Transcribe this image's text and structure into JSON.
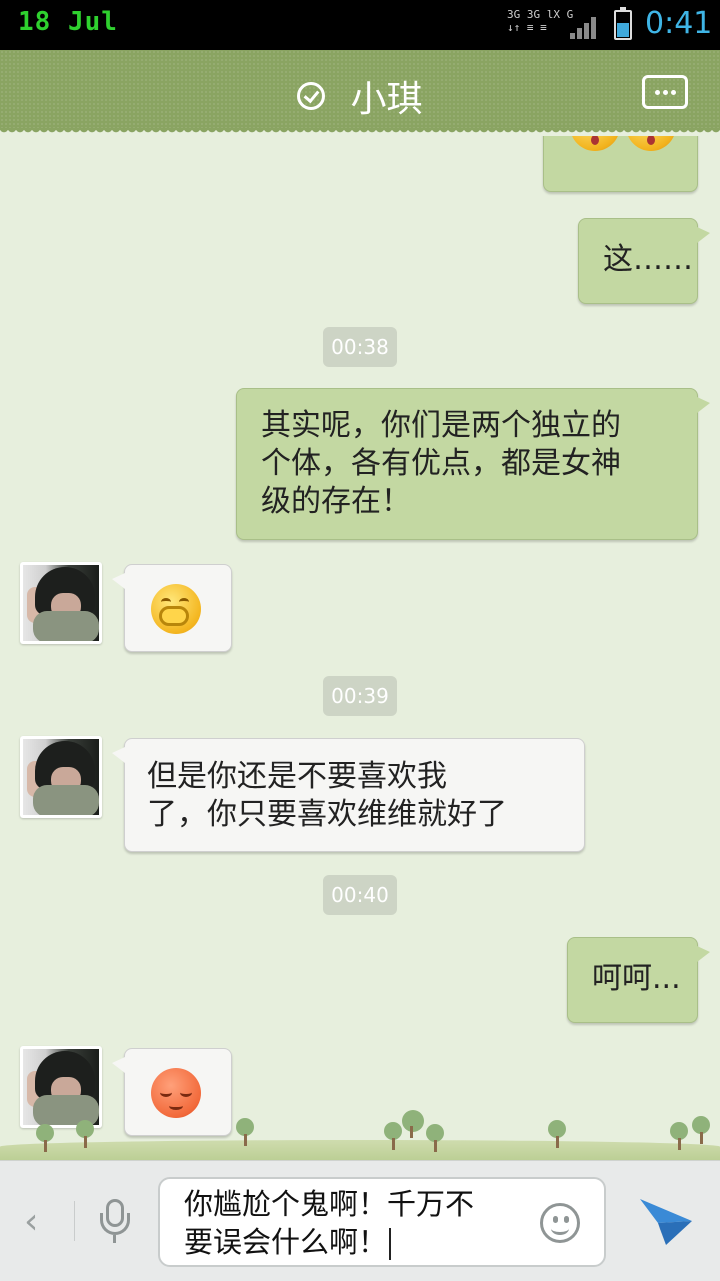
{
  "status_bar": {
    "date": "18 Jul",
    "network_top": "3G 3G lX G",
    "network_bottom": "↓↑ ≡ ≡",
    "time": "0:41",
    "battery_level": 0.55
  },
  "header": {
    "title": "小琪",
    "verified_icon": "check-circle-icon",
    "menu_icon": "more-dots-icon"
  },
  "messages": [
    {
      "side": "right",
      "type": "emoji",
      "emoji": [
        "shocked-face",
        "shocked-face"
      ]
    },
    {
      "side": "right",
      "type": "text",
      "text": "这……"
    },
    {
      "type": "time",
      "text": "00:38"
    },
    {
      "side": "right",
      "type": "text",
      "lines": [
        "其实呢，你们是两个独立的",
        "个体，各有优点，都是女神",
        "级的存在！"
      ]
    },
    {
      "side": "left",
      "type": "emoji",
      "emoji": [
        "hug-face"
      ]
    },
    {
      "type": "time",
      "text": "00:39"
    },
    {
      "side": "left",
      "type": "text",
      "lines": [
        "但是你还是不要喜欢我",
        "了，你只要喜欢维维就好了"
      ]
    },
    {
      "type": "time",
      "text": "00:40"
    },
    {
      "side": "right",
      "type": "text",
      "text": "呵呵..."
    },
    {
      "side": "left",
      "type": "emoji",
      "emoji": [
        "sleepy-face"
      ]
    }
  ],
  "input_bar": {
    "back_label": "‹",
    "text_line1": "你尴尬个鬼啊！千万不",
    "text_line2": "要误会什么啊！",
    "mic_icon": "microphone-icon",
    "emoji_icon": "smiley-icon",
    "send_icon": "send-plane-icon"
  },
  "colors": {
    "header_bg": "#8aa462",
    "chat_bg": "#e7efdd",
    "bubble_right": "#c3d8a2",
    "bubble_left": "#f6f6f4",
    "timestamp_bg": "#cdd4c5",
    "send_blue": "#3a8ad6"
  }
}
